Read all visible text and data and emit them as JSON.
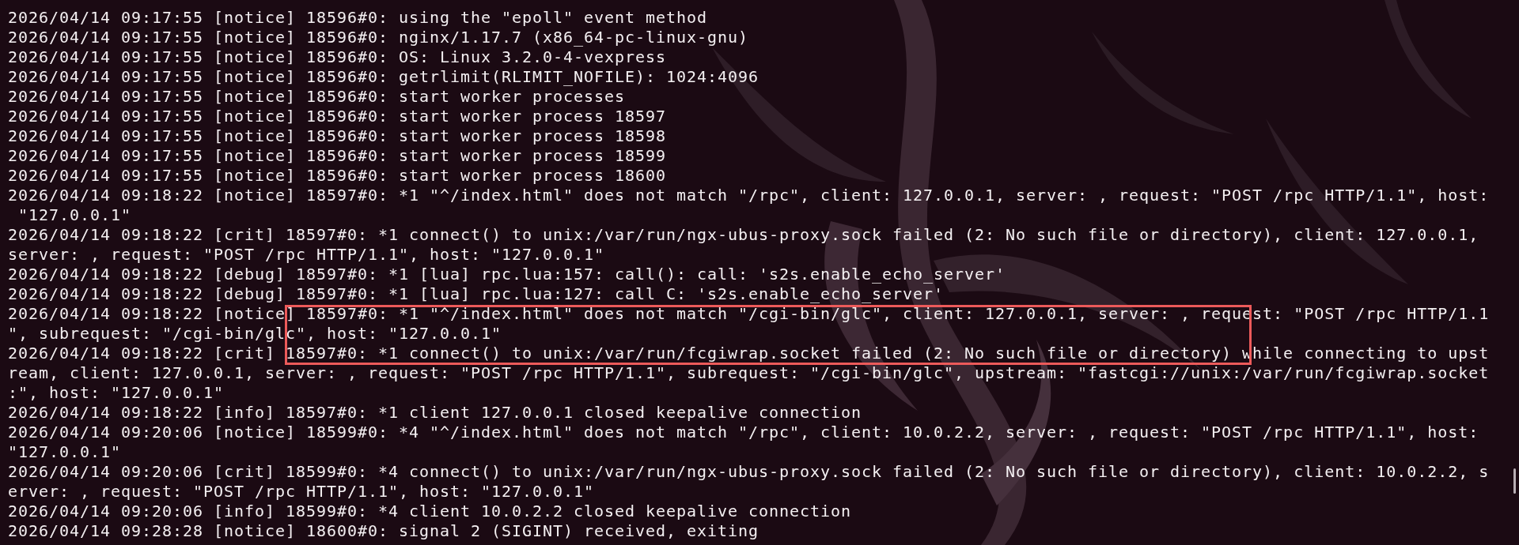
{
  "terminal": {
    "lines": [
      {
        "text": "2026/04/14 09:17:55 [notice] 18596#0: using the \"epoll\" event method",
        "highlighted": false
      },
      {
        "text": "2026/04/14 09:17:55 [notice] 18596#0: nginx/1.17.7 (x86_64-pc-linux-gnu)",
        "highlighted": false
      },
      {
        "text": "2026/04/14 09:17:55 [notice] 18596#0: OS: Linux 3.2.0-4-vexpress",
        "highlighted": false
      },
      {
        "text": "2026/04/14 09:17:55 [notice] 18596#0: getrlimit(RLIMIT_NOFILE): 1024:4096",
        "highlighted": false
      },
      {
        "text": "2026/04/14 09:17:55 [notice] 18596#0: start worker processes",
        "highlighted": false
      },
      {
        "text": "2026/04/14 09:17:55 [notice] 18596#0: start worker process 18597",
        "highlighted": false
      },
      {
        "text": "2026/04/14 09:17:55 [notice] 18596#0: start worker process 18598",
        "highlighted": false
      },
      {
        "text": "2026/04/14 09:17:55 [notice] 18596#0: start worker process 18599",
        "highlighted": false
      },
      {
        "text": "2026/04/14 09:17:55 [notice] 18596#0: start worker process 18600",
        "highlighted": false
      },
      {
        "text": "2026/04/14 09:18:22 [notice] 18597#0: *1 \"^/index.html\" does not match \"/rpc\", client: 127.0.0.1, server: , request: \"POST /rpc HTTP/1.1\", host:",
        "highlighted": false
      },
      {
        "text": " \"127.0.0.1\"",
        "highlighted": false
      },
      {
        "text": "2026/04/14 09:18:22 [crit] 18597#0: *1 connect() to unix:/var/run/ngx-ubus-proxy.sock failed (2: No such file or directory), client: 127.0.0.1,",
        "highlighted": false
      },
      {
        "text": "server: , request: \"POST /rpc HTTP/1.1\", host: \"127.0.0.1\"",
        "highlighted": false
      },
      {
        "text": "2026/04/14 09:18:22 [debug] 18597#0: *1 [lua] rpc.lua:157: call(): call: 's2s.enable_echo_server'",
        "highlighted": false
      },
      {
        "text": "2026/04/14 09:18:22 [debug] 18597#0: *1 [lua] rpc.lua:127: call C: 's2s.enable_echo_server'",
        "highlighted": false
      },
      {
        "text": "2026/04/14 09:18:22 [notice] 18597#0: *1 \"^/index.html\" does not match \"/cgi-bin/glc\", client: 127.0.0.1, server: , request: \"POST /rpc HTTP/1.1",
        "highlighted": true
      },
      {
        "text": "\", subrequest: \"/cgi-bin/glc\", host: \"127.0.0.1\"",
        "highlighted": true
      },
      {
        "text": "2026/04/14 09:18:22 [crit] 18597#0: *1 connect() to unix:/var/run/fcgiwrap.socket failed (2: No such file or directory) while connecting to upst",
        "highlighted": true
      },
      {
        "text": "ream, client: 127.0.0.1, server: , request: \"POST /rpc HTTP/1.1\", subrequest: \"/cgi-bin/glc\", upstream: \"fastcgi://unix:/var/run/fcgiwrap.socket",
        "highlighted": false
      },
      {
        "text": ":\", host: \"127.0.0.1\"",
        "highlighted": false
      },
      {
        "text": "2026/04/14 09:18:22 [info] 18597#0: *1 client 127.0.0.1 closed keepalive connection",
        "highlighted": false
      },
      {
        "text": "2026/04/14 09:20:06 [notice] 18599#0: *4 \"^/index.html\" does not match \"/rpc\", client: 10.0.2.2, server: , request: \"POST /rpc HTTP/1.1\", host:",
        "highlighted": false
      },
      {
        "text": "\"127.0.0.1\"",
        "highlighted": false
      },
      {
        "text": "2026/04/14 09:20:06 [crit] 18599#0: *4 connect() to unix:/var/run/ngx-ubus-proxy.sock failed (2: No such file or directory), client: 10.0.2.2, s",
        "highlighted": false
      },
      {
        "text": "erver: , request: \"POST /rpc HTTP/1.1\", host: \"127.0.0.1\"",
        "highlighted": false
      },
      {
        "text": "2026/04/14 09:20:06 [info] 18599#0: *4 client 10.0.2.2 closed keepalive connection",
        "highlighted": false
      },
      {
        "text": "2026/04/14 09:28:28 [notice] 18600#0: signal 2 (SIGINT) received, exiting",
        "highlighted": false
      }
    ]
  }
}
